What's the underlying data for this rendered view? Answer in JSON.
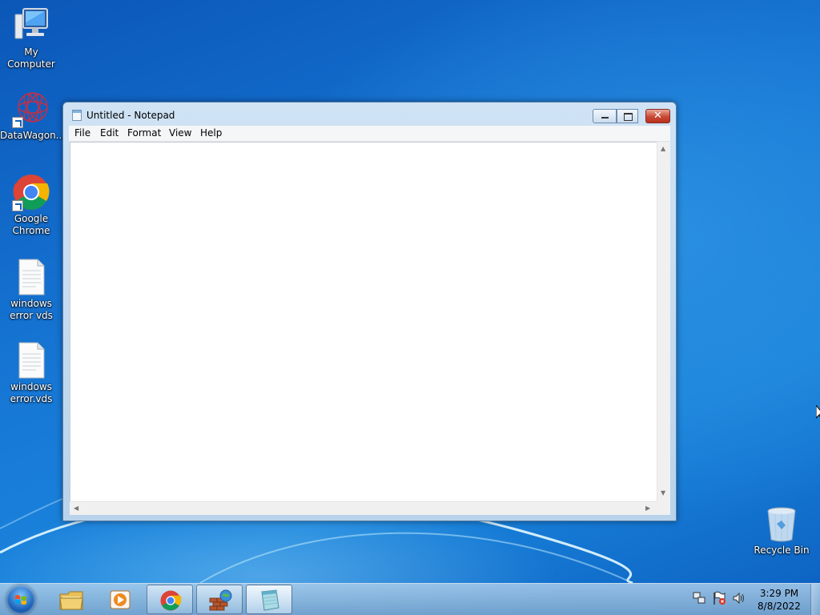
{
  "desktop": {
    "icons": [
      {
        "label": "My Computer",
        "icon": "computer-icon"
      },
      {
        "label": "DataWagon...",
        "icon": "datawagon-icon"
      },
      {
        "label": "Google Chrome",
        "icon": "chrome-icon"
      },
      {
        "label": "windows error vds",
        "icon": "text-file-icon"
      },
      {
        "label": "windows error.vds",
        "icon": "text-file-icon"
      }
    ],
    "recycle_bin": {
      "label": "Recycle Bin",
      "icon": "recycle-bin-icon"
    }
  },
  "notepad": {
    "title": "Untitled - Notepad",
    "menu": [
      "File",
      "Edit",
      "Format",
      "View",
      "Help"
    ],
    "content": "",
    "close_glyph": "✕"
  },
  "taskbar": {
    "items": [
      {
        "name": "start",
        "icon": "windows-logo-icon"
      },
      {
        "name": "file-explorer",
        "icon": "folder-icon"
      },
      {
        "name": "media-player",
        "icon": "media-player-icon"
      },
      {
        "name": "chrome",
        "icon": "chrome-icon"
      },
      {
        "name": "firewall",
        "icon": "firewall-icon"
      },
      {
        "name": "notepad",
        "icon": "notepad-icon"
      }
    ],
    "clock": {
      "time": "3:29 PM",
      "date": "8/8/2022"
    }
  },
  "colors": {
    "desktop_blue": "#1778d6",
    "close_red": "#c84a34",
    "window_frame": "#b9d3ec"
  }
}
